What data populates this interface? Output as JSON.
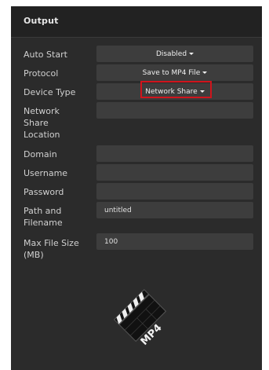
{
  "panel": {
    "title": "Output"
  },
  "rows": {
    "auto_start": {
      "label": "Auto Start",
      "value": "Disabled"
    },
    "protocol": {
      "label": "Protocol",
      "value": "Save to MP4 File"
    },
    "device_type": {
      "label": "Device Type",
      "value": "Network Share"
    },
    "network_share_location": {
      "label_lines": [
        "Network",
        "Share",
        "Location"
      ],
      "value": ""
    },
    "domain": {
      "label": "Domain",
      "value": ""
    },
    "username": {
      "label": "Username",
      "value": ""
    },
    "password": {
      "label": "Password",
      "value": ""
    },
    "path_and_filename": {
      "label_lines": [
        "Path and",
        "Filename"
      ],
      "value": "untitled"
    },
    "max_file_size": {
      "label_lines": [
        "Max File Size",
        "(MB)"
      ],
      "value": "100"
    }
  },
  "logo": {
    "text": "MP4",
    "icon": "clapperboard-icon"
  },
  "colors": {
    "panel_bg": "#2b2b2b",
    "header_bg": "#222222",
    "field_bg": "#3d3d3d",
    "highlight": "#d0141c"
  }
}
